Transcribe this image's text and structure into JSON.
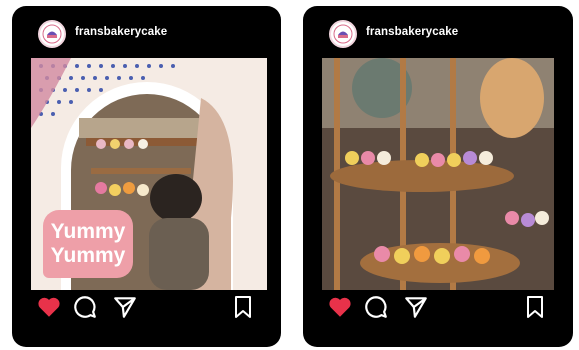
{
  "posts": [
    {
      "username": "fransbakerycake",
      "overlay": {
        "line1": "Yummy",
        "line2": "Yummy"
      },
      "liked": true
    },
    {
      "username": "fransbakerycake",
      "liked": true
    }
  ],
  "colors": {
    "heart": "#e8324a",
    "frame": "#000000",
    "overlay_pink": "#ee9fa8"
  },
  "icons": [
    "bakery-logo-icon",
    "heart-icon",
    "comment-icon",
    "share-icon",
    "bookmark-icon"
  ]
}
